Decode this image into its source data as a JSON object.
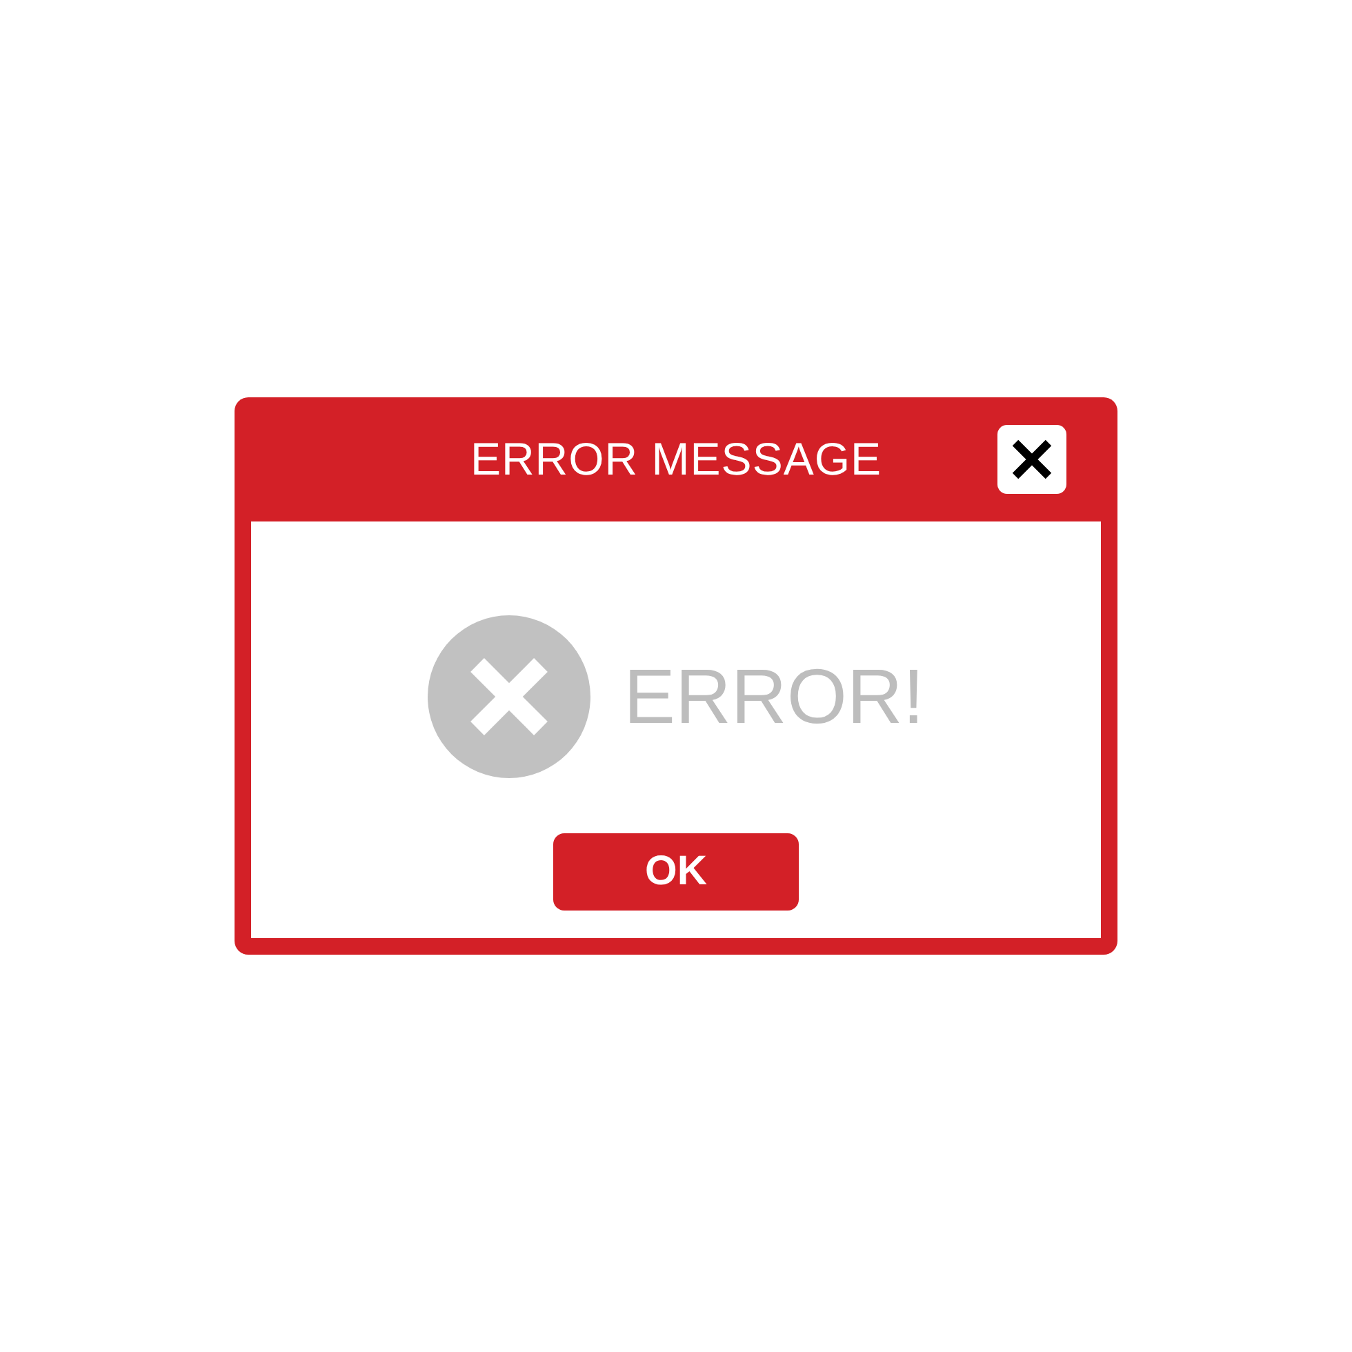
{
  "dialog": {
    "title": "ERROR MESSAGE",
    "message": "ERROR!",
    "buttons": [
      {
        "label": "OK"
      }
    ]
  }
}
